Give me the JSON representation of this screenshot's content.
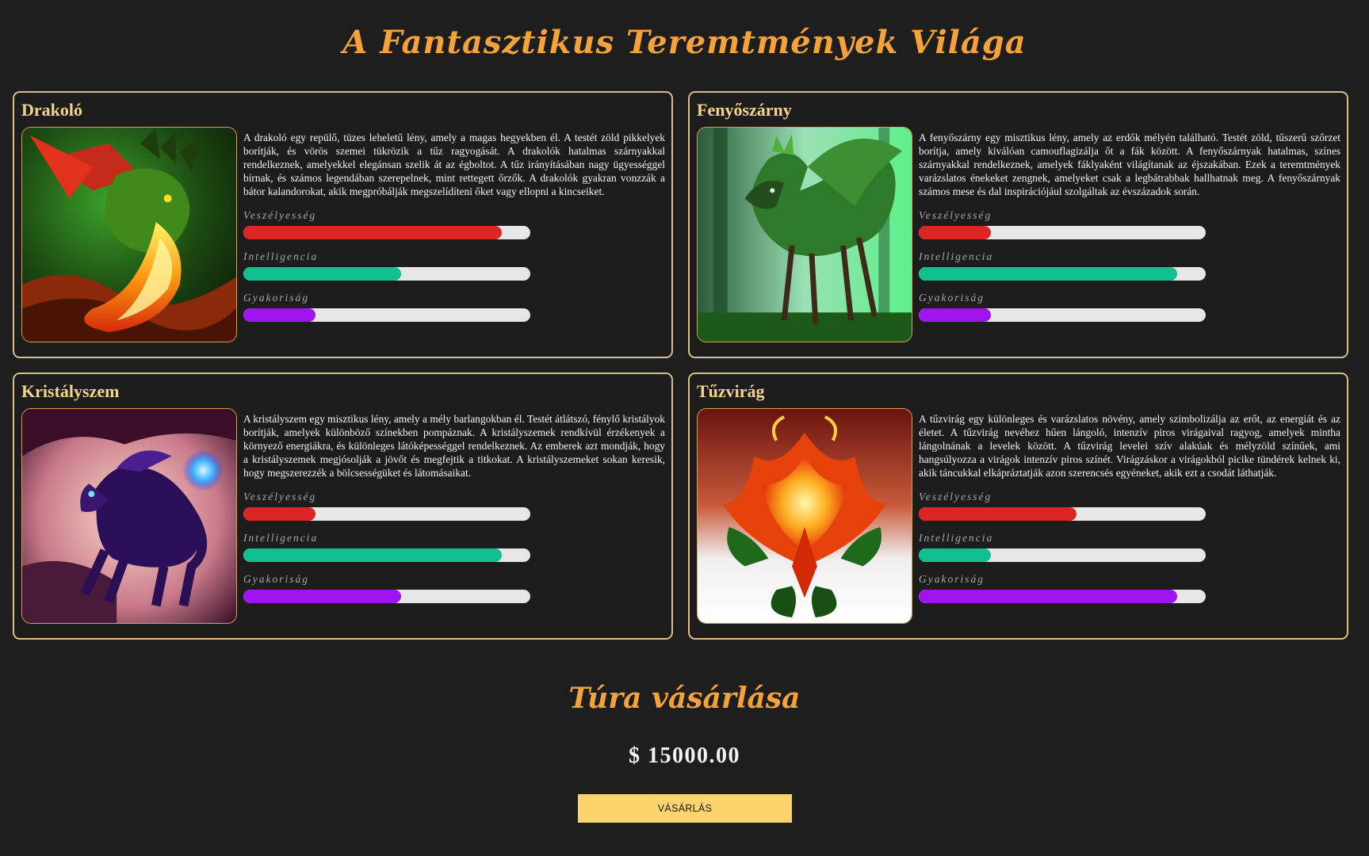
{
  "page": {
    "title": "A Fantasztikus Teremtmények Világa"
  },
  "creatures": [
    {
      "name": "Drakoló",
      "image_icon": "dragon-image",
      "description": "A drakoló egy repülő, tüzes leheletű lény, amely a magas hegyekben él. A testét zöld pikkelyek borítják, és vörös szemei tükrözik a tűz ragyogását. A drakolók hatalmas szárnyakkal rendelkeznek, amelyekkel elegánsan szelik át az égboltot. A tűz irányításában nagy ügyességgel bírnak, és számos legendában szerepelnek, mint rettegett őrzők. A drakolók gyakran vonzzák a bátor kalandorokat, akik megpróbálják megszelídíteni őket vagy ellopni a kincseiket.",
      "stats": [
        {
          "label": "Veszélyesség",
          "level": 0.9
        },
        {
          "label": "Intelligencia",
          "level": 0.55
        },
        {
          "label": "Gyakoriság",
          "level": 0.25
        }
      ]
    },
    {
      "name": "Fenyőszárny",
      "image_icon": "forest-creature-image",
      "description": "A fenyőszárny egy misztikus lény, amely az erdők mélyén található. Testét zöld, tűszerű szőrzet borítja, amely kiválóan camouflagizálja őt a fák között. A fenyőszárnyak hatalmas, színes szárnyakkal rendelkeznek, amelyek fáklyaként világítanak az éjszakában. Ezek a teremtmények varázslatos énekeket zengnek, amelyeket csak a legbátrabbak hallhatnak meg. A fenyőszárnyak számos mese és dal inspirációjául szolgáltak az évszázadok során.",
      "stats": [
        {
          "label": "Veszélyesség",
          "level": 0.25
        },
        {
          "label": "Intelligencia",
          "level": 0.9
        },
        {
          "label": "Gyakoriság",
          "level": 0.25
        }
      ]
    },
    {
      "name": "Kristályszem",
      "image_icon": "crystal-horse-image",
      "description": "A kristályszem egy misztikus lény, amely a mély barlangokban él. Testét átlátszó, fénylő kristályok borítják, amelyek különböző színekben pompáznak. A kristályszemek rendkívül érzékenyek a környező energiákra, és különleges látóképességgel rendelkeznek. Az emberek azt mondják, hogy a kristályszemek megjósolják a jövőt és megfejtik a titkokat. A kristályszemeket sokan keresik, hogy megszerezzék a bölcsességüket és látomásaikat.",
      "stats": [
        {
          "label": "Veszélyesség",
          "level": 0.25
        },
        {
          "label": "Intelligencia",
          "level": 0.9
        },
        {
          "label": "Gyakoriság",
          "level": 0.55
        }
      ]
    },
    {
      "name": "Tűzvirág",
      "image_icon": "fire-flower-image",
      "description": "A tűzvirág egy különleges és varázslatos növény, amely szimbolizálja az erőt, az energiát és az életet. A tűzvirág nevéhez hűen lángoló, intenzív piros virágaival ragyog, amelyek mintha lángolnának a levelek között. A tűzvirág levelei szív alakúak és mélyzöld színűek, ami hangsúlyozza a virágok intenzív piros színét. Virágzáskor a virágokból picike tündérek kelnek ki, akik táncukkal elkápráztatják azon szerencsés egyéneket, akik ezt a csodát láthatják.",
      "stats": [
        {
          "label": "Veszélyesség",
          "level": 0.55
        },
        {
          "label": "Intelligencia",
          "level": 0.25
        },
        {
          "label": "Gyakoriság",
          "level": 0.9
        }
      ]
    }
  ],
  "purchase": {
    "title": "Túra vásárlása",
    "price": "$ 15000.00",
    "button_label": "VÁSÁRLÁS"
  },
  "colors": {
    "accent": "#f5a23a",
    "card_border": "#d9bf85",
    "danger": "#dc2626",
    "intelligence": "#10c08e",
    "frequency": "#a014f0",
    "button": "#fdd36b"
  }
}
